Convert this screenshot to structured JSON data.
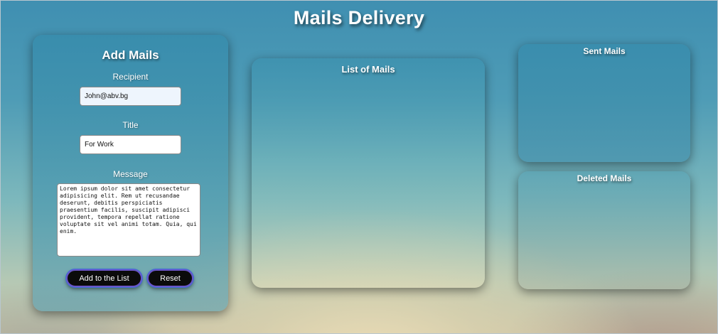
{
  "page": {
    "title": "Mails Delivery"
  },
  "add_form": {
    "heading": "Add Mails",
    "recipient_label": "Recipient",
    "recipient_value": "John@abv.bg",
    "title_label": "Title",
    "title_value": "For Work",
    "message_label": "Message",
    "message_value": "Lorem ipsum dolor sit amet consectetur adipisicing elit. Rem ut recusandae deserunt, debitis perspiciatis praesentium facilis, suscipit adipisci provident, tempora repellat ratione voluptate sit vel animi totam. Quia, qui enim.",
    "add_button_label": "Add to the List",
    "reset_button_label": "Reset"
  },
  "list_panel": {
    "heading": "List of Mails"
  },
  "sent_panel": {
    "heading": "Sent Mails"
  },
  "deleted_panel": {
    "heading": "Deleted Mails"
  },
  "colors": {
    "button_background": "#0b0b0b",
    "button_border": "#6a55c8",
    "panel_tint": "#3c8caa"
  }
}
